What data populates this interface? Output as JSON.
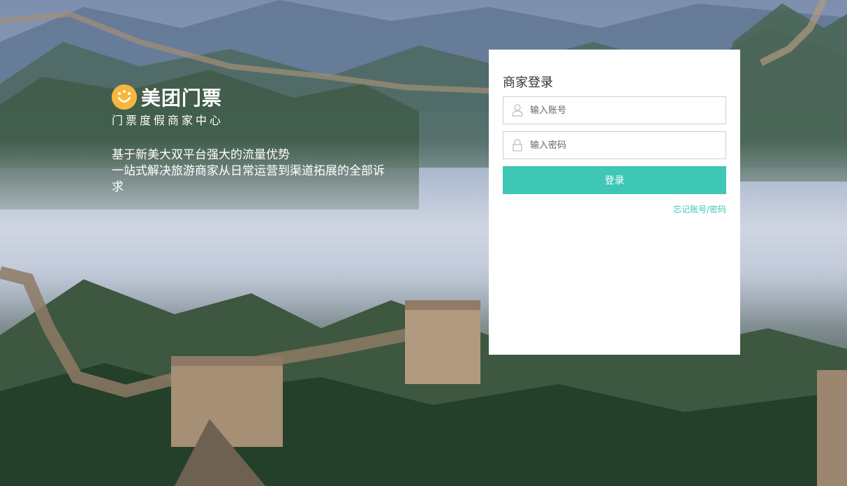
{
  "brand": {
    "logo_text": "美团门票",
    "subtitle": "门票度假商家中心"
  },
  "slogan": {
    "line1": "基于新美大双平台强大的流量优势",
    "line2": "一站式解决旅游商家从日常运营到渠道拓展的全部诉求"
  },
  "login": {
    "title": "商家登录",
    "account_placeholder": "输入账号",
    "password_placeholder": "输入密码",
    "submit_label": "登录",
    "forgot_label": "忘记账号/密码"
  },
  "colors": {
    "accent": "#3ec7b4",
    "logo": "#f6b73c"
  },
  "icons": {
    "account": "user-icon",
    "password": "lock-icon"
  }
}
